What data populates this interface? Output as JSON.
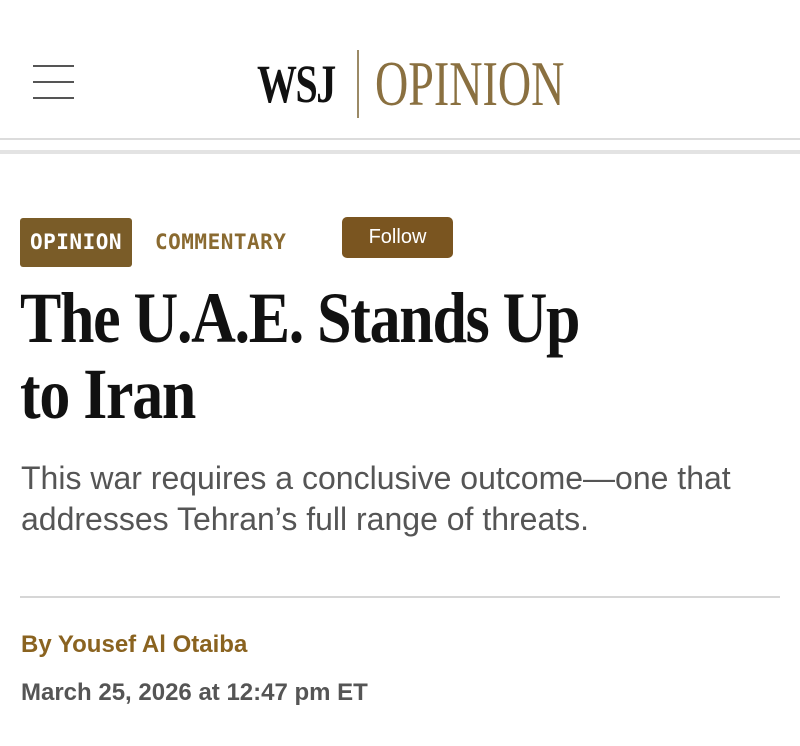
{
  "header": {
    "menu_icon": "hamburger-menu-icon",
    "logo_wsj": "WSJ",
    "logo_section": "OPINION"
  },
  "tags": {
    "section": "OPINION",
    "category": "COMMENTARY",
    "follow_label": "Follow"
  },
  "article": {
    "headline": "The U.A.E. Stands Up to Iran",
    "dek": "This war requires a conclusive outcome—one that addresses Tehran’s full range of threats.",
    "byline_prefix": "By",
    "author": "Yousef Al Otaiba",
    "timestamp": "March 25, 2026 at 12:47 pm ET"
  },
  "colors": {
    "brand_brown": "#7a5c28",
    "opinion_gold": "#8a7040",
    "text_dark": "#111111",
    "text_gray": "#555555"
  }
}
